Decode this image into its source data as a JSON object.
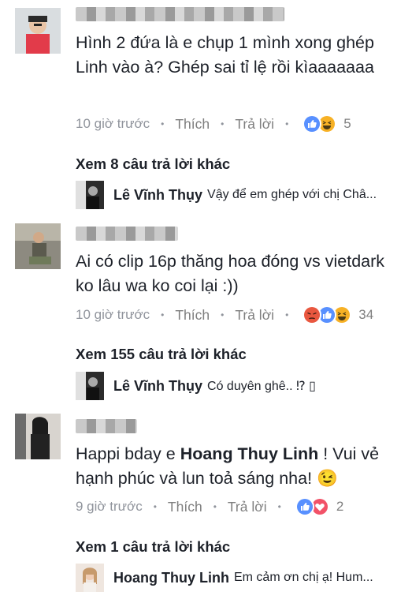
{
  "comments": [
    {
      "text": "Hình 2 đứa là e chụp 1 mình xong ghép Linh vào à? Ghép sai tỉ lệ rồi kìaaaaaaa",
      "time": "10 giờ trước",
      "like_label": "Thích",
      "reply_label": "Trả lời",
      "reactions": [
        "like-icon",
        "haha-icon"
      ],
      "reaction_count": "5",
      "more_replies": "Xem 8 câu trả lời khác",
      "reply": {
        "name": "Lê Vĩnh Thụy",
        "text": "Vậy để em ghép với chị Châ..."
      }
    },
    {
      "text": "Ai có clip 16p thăng hoa đóng vs vietdark ko lâu wa ko coi lại :))",
      "time": "10 giờ trước",
      "like_label": "Thích",
      "reply_label": "Trả lời",
      "reactions": [
        "angry-icon",
        "like-icon",
        "haha-icon"
      ],
      "reaction_count": "34",
      "more_replies": "Xem 155 câu trả lời khác",
      "reply": {
        "name": "Lê Vĩnh Thụy",
        "text": "Có duyên ghê.. ⁉ ▯"
      }
    },
    {
      "text_before": "Happi bday e ",
      "mention": "Hoang Thuy Linh",
      "text_after": " ! Vui vẻ hạnh phúc và lun toả sáng nha! 😉",
      "time": "9 giờ trước",
      "like_label": "Thích",
      "reply_label": "Trả lời",
      "reactions": [
        "like-icon",
        "love-icon"
      ],
      "reaction_count": "2",
      "more_replies": "Xem 1 câu trả lời khác",
      "reply": {
        "name": "Hoang Thuy Linh",
        "text": "Em cảm ơn chị ạ!  Hum..."
      }
    }
  ],
  "colors": {
    "like_blue": "#5890ff",
    "haha_yellow": "#f7b125",
    "angry_red": "#e9573f",
    "love_red": "#f25268",
    "meta_gray": "#90949c"
  }
}
